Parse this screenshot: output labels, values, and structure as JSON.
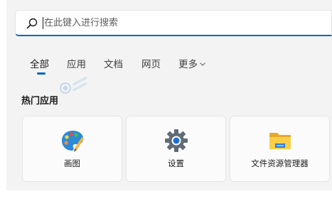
{
  "search": {
    "placeholder": "在此键入进行搜索"
  },
  "tabs": [
    {
      "label": "全部",
      "active": true
    },
    {
      "label": "应用",
      "active": false
    },
    {
      "label": "文档",
      "active": false
    },
    {
      "label": "网页",
      "active": false
    },
    {
      "label": "更多",
      "active": false,
      "has_dropdown": true
    }
  ],
  "section": {
    "title": "热门应用"
  },
  "apps": [
    {
      "label": "画图",
      "icon": "paint-palette-icon"
    },
    {
      "label": "设置",
      "icon": "gear-icon"
    },
    {
      "label": "文件资源管理器",
      "icon": "folder-icon"
    }
  ],
  "colors": {
    "accent": "#0067c0",
    "panel_background": "#f3f3f3",
    "card_background": "#fbfbfb"
  }
}
